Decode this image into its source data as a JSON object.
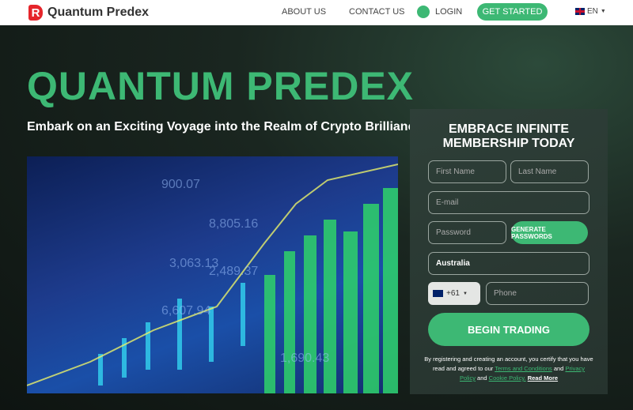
{
  "nav": {
    "logo_letter": "R",
    "brand": "Quantum Predex",
    "about": "ABOUT US",
    "contact": "CONTACT US",
    "login": "LOGIN",
    "get_started": "GET STARTED",
    "language": "EN"
  },
  "hero": {
    "title": "QUANTUM PREDEX",
    "subtitle": "Embark on an Exciting Voyage into the Realm of Crypto Brilliance"
  },
  "form": {
    "heading_line1": "EMBRACE INFINITE",
    "heading_line2": "MEMBERSHIP TODAY",
    "first_name": "First Name",
    "last_name": "Last Name",
    "email": "E-mail",
    "password": "Password",
    "generate": "GENERATE PASSWORDS",
    "country": "Australia",
    "dial_code": "+61",
    "phone": "Phone",
    "submit": "BEGIN TRADING",
    "legal_pre": "By registering and creating an account, you certify that you have read and agreed to our",
    "terms": "Terms and Conditions",
    "and1": "and",
    "privacy": "Privacy Policy",
    "and2": "and",
    "cookie": "Cookie Policy.",
    "read_more": "Read More"
  },
  "colors": {
    "accent": "#3db874",
    "logo": "#e5252b"
  }
}
